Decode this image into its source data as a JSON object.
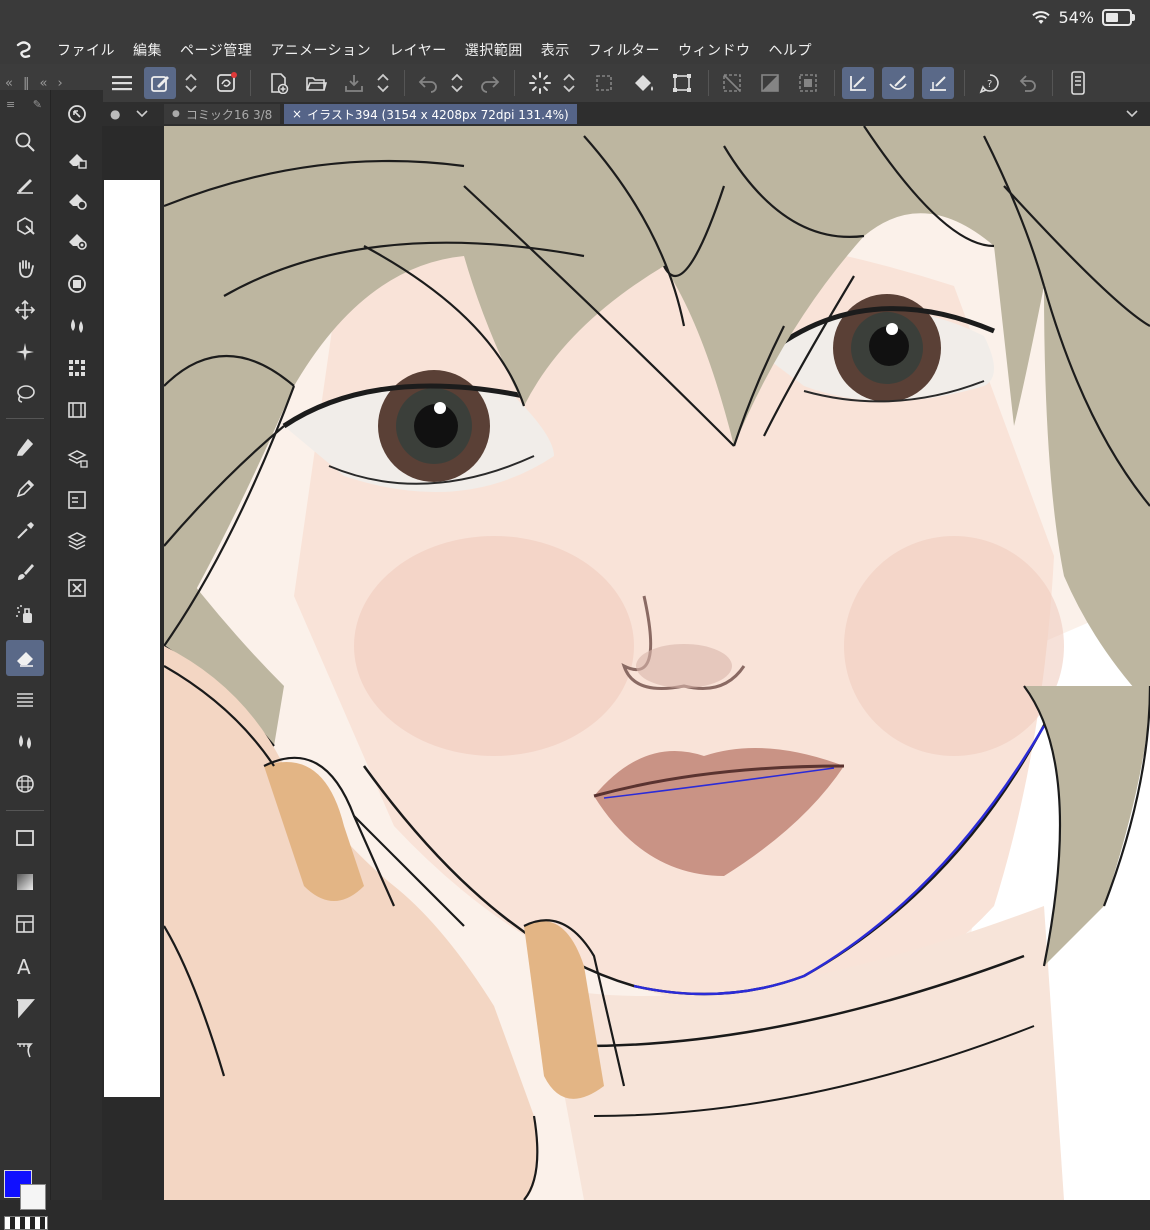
{
  "status": {
    "battery_text": "54%",
    "battery_level": 0.54
  },
  "menu": [
    "ファイル",
    "編集",
    "ページ管理",
    "アニメーション",
    "レイヤー",
    "選択範囲",
    "表示",
    "フィルター",
    "ウィンドウ",
    "ヘルプ"
  ],
  "tabs": {
    "inactive_label": "コミック16 3/8",
    "active_label": "イラスト394 (3154 x 4208px 72dpi 131.4%)"
  },
  "colors": {
    "main": "#1010ff",
    "sub": "#f5f5f5",
    "accent": "#5a6988"
  },
  "tools": [
    "magnifier",
    "operation",
    "object",
    "hand",
    "move",
    "auto-select",
    "lasso",
    "pen",
    "pencil",
    "eyedropper",
    "brush",
    "airbrush",
    "eraser",
    "hatching",
    "blend",
    "grid",
    "rectangle",
    "gradient",
    "frame",
    "text",
    "figure",
    "ruler"
  ],
  "active_tool": "eraser"
}
